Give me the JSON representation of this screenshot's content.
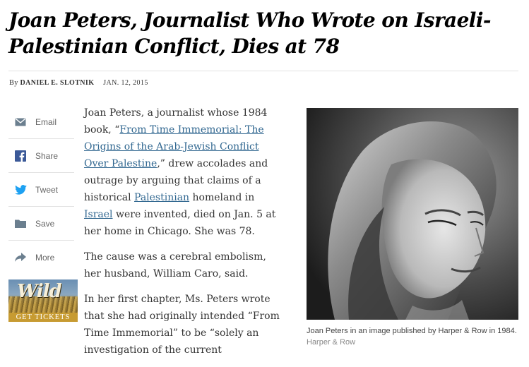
{
  "article": {
    "headline_line1": "Joan Peters, Journalist Who Wrote on Israeli-",
    "headline_line2": "Palestinian Conflict, Dies at 78",
    "byline_prefix": "By",
    "author": "DANIEL E. SLOTNIK",
    "date": "JAN. 12, 2015"
  },
  "share": {
    "items": [
      {
        "label": "Email",
        "icon": "envelope-icon"
      },
      {
        "label": "Share",
        "icon": "facebook-icon"
      },
      {
        "label": "Tweet",
        "icon": "twitter-icon"
      },
      {
        "label": "Save",
        "icon": "folder-icon"
      },
      {
        "label": "More",
        "icon": "share-arrow-icon"
      }
    ]
  },
  "ad": {
    "logo_text": "Wild",
    "cta": "GET TICKETS"
  },
  "body": {
    "p1": {
      "t1": "Joan Peters, a journalist whose 1984 book, “",
      "link1": "From Time Immemorial: The Origins of the Arab-Jewish Conflict Over Palestine",
      "t2": ",” drew accolades and outrage by arguing that claims of a historical ",
      "link2": "Palestinian",
      "t3": " homeland in ",
      "link3": "Israel",
      "t4": " were invented, died on Jan. 5 at her home in Chicago. She was 78."
    },
    "p2": "The cause was a cerebral embolism, her husband, William Caro, said.",
    "p3": "In her first chapter, Ms. Peters wrote that she had originally intended “From Time Immemorial” to be “solely an investigation of the current"
  },
  "photo": {
    "caption": "Joan Peters in an image published by Harper & Row in 1984.",
    "credit": "Harper & Row"
  },
  "colors": {
    "link": "#326891",
    "twitter": "#1da1f2",
    "facebook": "#3b5998",
    "icon_gray": "#666666"
  }
}
